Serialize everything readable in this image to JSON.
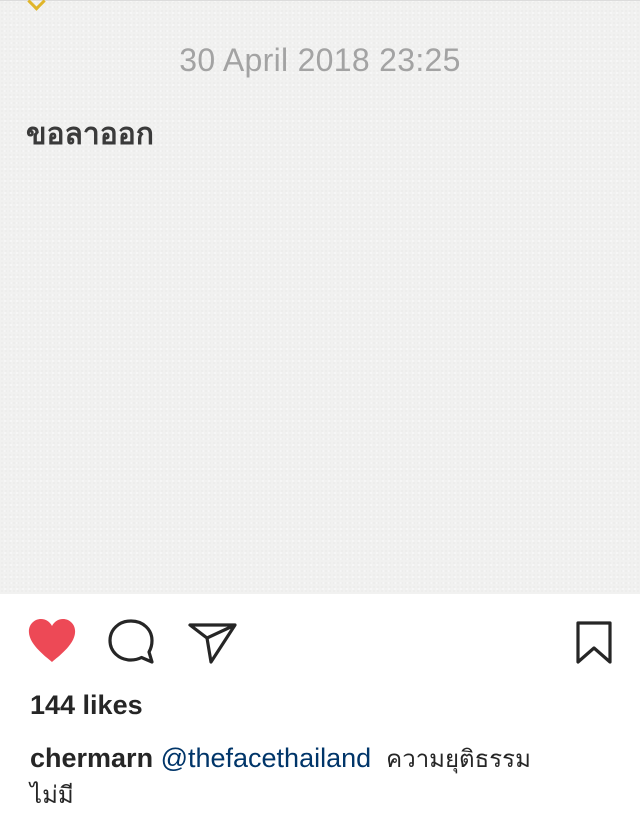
{
  "note": {
    "date": "30 April 2018 23:25",
    "text": "ขอลาออก"
  },
  "actions": {
    "like_icon": "heart-filled-icon",
    "comment_icon": "speech-bubble-icon",
    "share_icon": "paper-plane-icon",
    "save_icon": "bookmark-icon",
    "like_color": "#ed4956"
  },
  "post": {
    "likes": "144 likes",
    "username": "chermarn",
    "mention": "@thefacethailand",
    "caption_line1": "ความยุติธรรม",
    "caption_line2": "ไม่มี"
  }
}
